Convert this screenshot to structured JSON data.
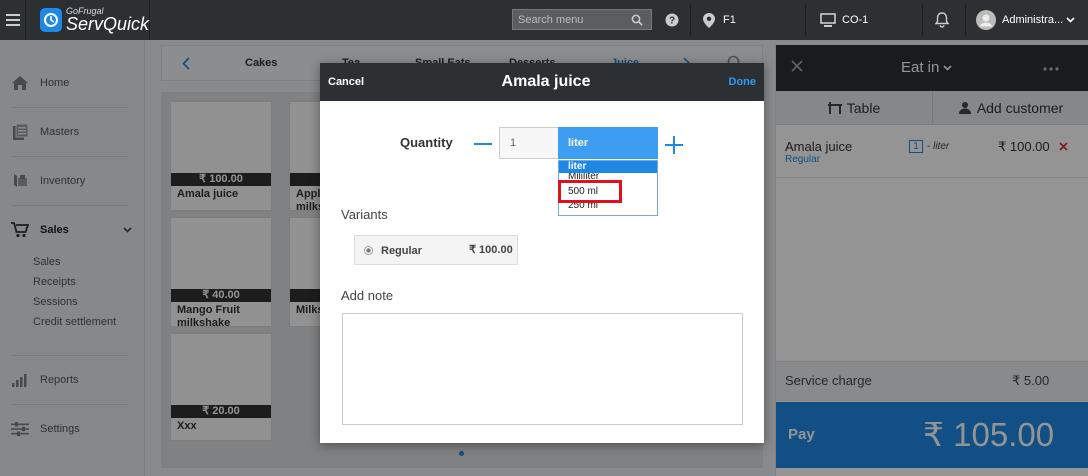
{
  "app": {
    "brand_small": "GoFrugal",
    "brand_big": "ServQuick"
  },
  "topbar": {
    "search_placeholder": "Search menu",
    "location": "F1",
    "counter": "CO-1",
    "user": "Administra..."
  },
  "sidebar": {
    "items": [
      {
        "label": "Home",
        "icon": "home-icon"
      },
      {
        "label": "Masters",
        "icon": "masters-icon"
      },
      {
        "label": "Inventory",
        "icon": "inventory-icon"
      },
      {
        "label": "Sales",
        "icon": "cart-icon"
      },
      {
        "label": "Reports",
        "icon": "reports-icon"
      },
      {
        "label": "Settings",
        "icon": "settings-icon"
      }
    ],
    "sales_sub": [
      "Sales",
      "Receipts",
      "Sessions",
      "Credit settlement"
    ]
  },
  "categories": [
    "Cakes",
    "Tea",
    "Small Eats",
    "Desserts",
    "Juice"
  ],
  "products": [
    {
      "price": "₹ 100.00",
      "name": "Amala juice",
      "name2": ""
    },
    {
      "price": "",
      "name": "Appl",
      "name2": "milks"
    },
    {
      "price": "₹ 40.00",
      "name": "Mango Fruit",
      "name2": "milkshake"
    },
    {
      "price": "",
      "name": "Milks",
      "name2": ""
    },
    {
      "price": "₹ 20.00",
      "name": "Xxx",
      "name2": ""
    }
  ],
  "order": {
    "mode": "Eat in",
    "table_label": "Table",
    "add_customer_label": "Add customer",
    "line": {
      "name": "Amala juice",
      "variant": "Regular",
      "qty": "1",
      "unit": "- liter",
      "amount": "₹ 100.00"
    },
    "service_charge_label": "Service charge",
    "service_charge": "₹ 5.00",
    "pay_label": "Pay",
    "total": "₹ 105.00"
  },
  "modal": {
    "cancel": "Cancel",
    "title": "Amala juice",
    "done": "Done",
    "quantity_label": "Quantity",
    "quantity": "1",
    "unit_selected": "liter",
    "unit_options": [
      "liter",
      "Mililiter",
      "500 ml",
      "250 ml"
    ],
    "variants_label": "Variants",
    "variant": {
      "name": "Regular",
      "price": "₹ 100.00"
    },
    "note_label": "Add note"
  },
  "colors": {
    "accent": "#1e88e5",
    "topbar": "#2d3033",
    "highlight": "#e0101f"
  }
}
